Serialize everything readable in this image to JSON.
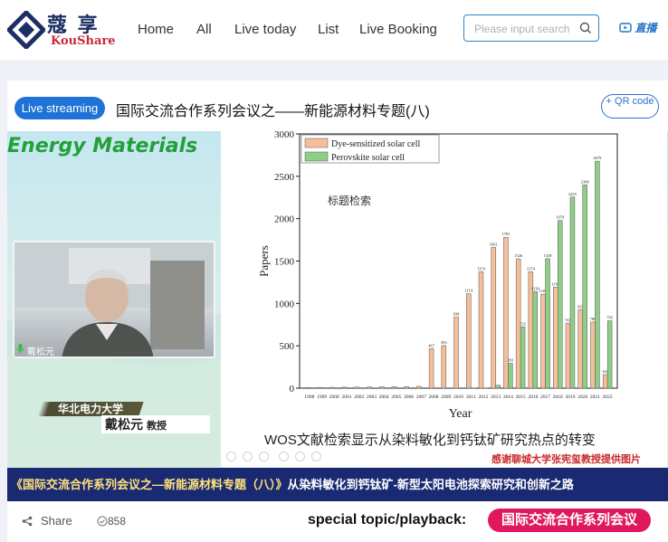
{
  "brand": {
    "name_cn": "蔻 享",
    "name_en": "KouShare"
  },
  "nav": {
    "items": [
      {
        "label": "Home"
      },
      {
        "label": "All"
      },
      {
        "label": "Live today"
      },
      {
        "label": "List"
      },
      {
        "label": "Live Booking"
      }
    ]
  },
  "search": {
    "placeholder": "Please input search"
  },
  "header_live_link": "直播",
  "colors": {
    "accent": "#1f72d6",
    "topic": "#e0195e",
    "ticker_bg": "#1a2a72",
    "ticker_text": "#ffe27a",
    "ad_green": "#22a03a",
    "dye_bar": "#f6bf99",
    "perov_bar": "#8ecf87"
  },
  "player": {
    "live_badge": "Live streaming",
    "title": "国际交流合作系列会议之——新能源材料专题(八)",
    "qr_label": "+ QR code",
    "ad_title": "Energy Materials",
    "camera_name": "戴松元",
    "institution": "华北电力大学",
    "speaker_name": "戴松元",
    "speaker_role": "教授",
    "slide_caption": "WOS文献检索显示从染料敏化到钙钛矿研究热点的转变",
    "slide_credit": "感谢聊城大学张宪玺教授提供图片",
    "ticker_prefix": "《国际交流合作系列会议之—新能源材料专题（八）》",
    "ticker_text": "从染料敏化到钙钛矿-新型太阳电池探索研究和创新之路"
  },
  "footer": {
    "share_label": "Share",
    "views": "858",
    "special_label": "special topic/playback:",
    "topic_button": "国际交流合作系列会议"
  },
  "chart_data": {
    "type": "bar",
    "ylabel": "Papers",
    "xlabel": "Year",
    "annotation": "标题检索",
    "ylim": [
      0,
      3000
    ],
    "yticks": [
      0,
      500,
      1000,
      1500,
      2000,
      2500,
      3000
    ],
    "legend_position": "top-left",
    "categories": [
      "1998",
      "1999",
      "2000",
      "2001",
      "2002",
      "2003",
      "2004",
      "2005",
      "2006",
      "2007",
      "2008",
      "2009",
      "2010",
      "2011",
      "2012",
      "2013",
      "2014",
      "2015",
      "2016",
      "2017",
      "2018",
      "2019",
      "2020",
      "2021",
      "2022"
    ],
    "series": [
      {
        "name": "Dye-sensitized solar cell",
        "values": [
          8,
          9,
          10,
          12,
          13,
          14,
          16,
          17,
          19,
          22,
          467,
          503,
          838,
          1114,
          1374,
          1661,
          1781,
          1526,
          1374,
          1109,
          1193,
          765,
          925,
          780,
          161
        ]
      },
      {
        "name": "Perovskite solar cell",
        "values": [
          0,
          0,
          0,
          0,
          0,
          0,
          0,
          0,
          0,
          0,
          0,
          0,
          0,
          1,
          2,
          34,
          293,
          722,
          1139,
          1528,
          1979,
          2255,
          2398,
          2679,
          795
        ]
      }
    ]
  }
}
